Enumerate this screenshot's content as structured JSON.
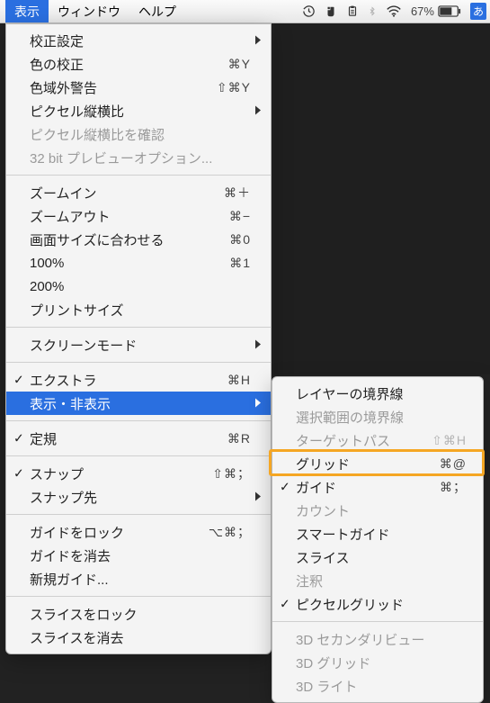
{
  "menubar": {
    "items": [
      "表示",
      "ウィンドウ",
      "ヘルプ"
    ],
    "active_index": 0,
    "battery_pct": "67%",
    "ime": "あ"
  },
  "menu": {
    "groups": [
      [
        {
          "label": "校正設定",
          "submenu": true
        },
        {
          "label": "色の校正",
          "shortcut": "⌘Y"
        },
        {
          "label": "色域外警告",
          "shortcut": "⇧⌘Y"
        },
        {
          "label": "ピクセル縦横比",
          "submenu": true
        },
        {
          "label": "ピクセル縦横比を確認",
          "disabled": true
        },
        {
          "label": "32 bit プレビューオプション...",
          "disabled": true
        }
      ],
      [
        {
          "label": "ズームイン",
          "shortcut": "⌘＋"
        },
        {
          "label": "ズームアウト",
          "shortcut": "⌘−"
        },
        {
          "label": "画面サイズに合わせる",
          "shortcut": "⌘0"
        },
        {
          "label": "100%",
          "shortcut": "⌘1"
        },
        {
          "label": "200%"
        },
        {
          "label": "プリントサイズ"
        }
      ],
      [
        {
          "label": "スクリーンモード",
          "submenu": true
        }
      ],
      [
        {
          "label": "エクストラ",
          "shortcut": "⌘H",
          "checked": true
        },
        {
          "label": "表示・非表示",
          "submenu": true,
          "selected": true
        }
      ],
      [
        {
          "label": "定規",
          "shortcut": "⌘R",
          "checked": true
        }
      ],
      [
        {
          "label": "スナップ",
          "shortcut": "⇧⌘；",
          "checked": true
        },
        {
          "label": "スナップ先",
          "submenu": true
        }
      ],
      [
        {
          "label": "ガイドをロック",
          "shortcut": "⌥⌘；"
        },
        {
          "label": "ガイドを消去"
        },
        {
          "label": "新規ガイド..."
        }
      ],
      [
        {
          "label": "スライスをロック"
        },
        {
          "label": "スライスを消去"
        }
      ]
    ]
  },
  "submenu": {
    "groups": [
      [
        {
          "label": "レイヤーの境界線"
        },
        {
          "label": "選択範囲の境界線",
          "disabled": true
        },
        {
          "label": "ターゲットパス",
          "shortcut": "⇧⌘H",
          "disabled": true
        },
        {
          "label": "グリッド",
          "shortcut": "⌘@",
          "highlight": true
        },
        {
          "label": "ガイド",
          "shortcut": "⌘；",
          "checked": true
        },
        {
          "label": "カウント",
          "disabled": true
        },
        {
          "label": "スマートガイド"
        },
        {
          "label": "スライス"
        },
        {
          "label": "注釈",
          "disabled": true
        },
        {
          "label": "ピクセルグリッド",
          "checked": true
        }
      ],
      [
        {
          "label": "3D セカンダリビュー",
          "disabled": true
        },
        {
          "label": "3D グリッド",
          "disabled": true
        },
        {
          "label": "3D ライト",
          "disabled": true
        }
      ]
    ]
  }
}
